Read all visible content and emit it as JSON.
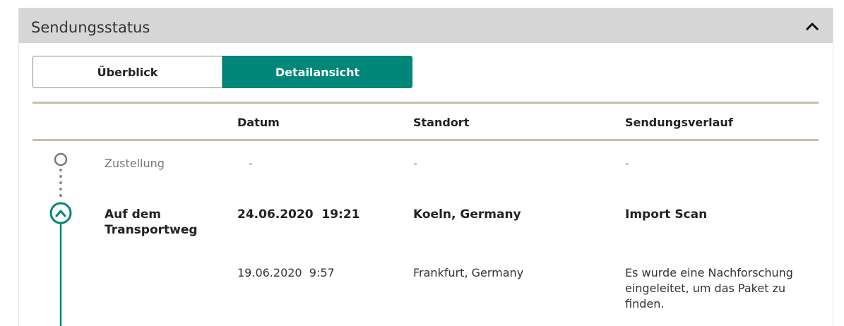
{
  "panel": {
    "title": "Sendungsstatus"
  },
  "tabs": [
    {
      "label": "Überblick",
      "active": false
    },
    {
      "label": "Detailansicht",
      "active": true
    }
  ],
  "table": {
    "headers": [
      "",
      "Datum",
      "Standort",
      "Sendungsverlauf"
    ],
    "rows": [
      {
        "status": "Zustellung",
        "date": "-",
        "location": "-",
        "history": "-"
      },
      {
        "status": "Auf dem Transportweg",
        "date": "24.06.2020  19:21",
        "location": "Koeln, Germany",
        "history": "Import Scan"
      },
      {
        "status": "",
        "date": "19.06.2020  9:57",
        "location": "Frankfurt, Germany",
        "history": "Es wurde eine Nachforschung eingeleitet, um das Paket zu finden."
      }
    ]
  },
  "colors": {
    "header_bg": "#d6d6d6",
    "accent": "#00877a",
    "rule": "#c9bdb0",
    "pending_gray": "#777777"
  }
}
